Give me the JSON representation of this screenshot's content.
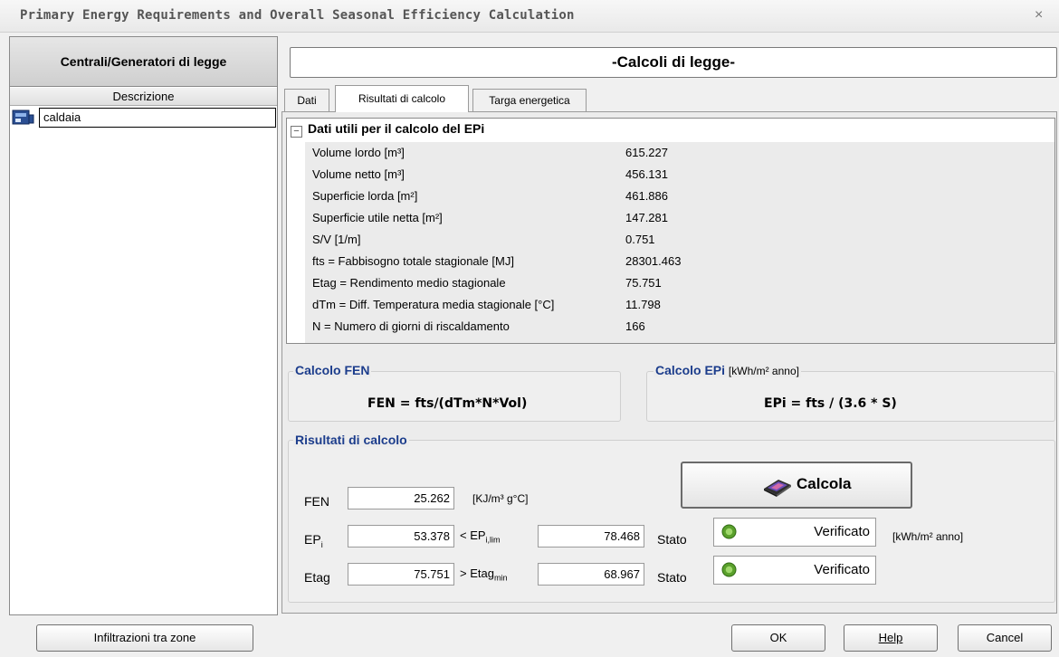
{
  "window": {
    "title": "Primary Energy Requirements and Overall Seasonal Efficiency Calculation",
    "close_glyph": "×"
  },
  "left_panel": {
    "header": "Centrali/Generatori di legge",
    "column_header": "Descrizione",
    "items": [
      {
        "label": "caldaia",
        "icon": "generator-icon"
      }
    ]
  },
  "main": {
    "banner": "-Calcoli di legge-",
    "tabs": [
      {
        "label": "Dati"
      },
      {
        "label": "Risultati di calcolo",
        "active": true
      },
      {
        "label": "Targa energetica"
      }
    ],
    "grid": {
      "expand_glyph": "−",
      "title": "Dati utili per il calcolo del EPi",
      "rows": [
        {
          "label": "Volume lordo [m³]",
          "value": "615.227"
        },
        {
          "label": "Volume netto [m³]",
          "value": "456.131"
        },
        {
          "label": "Superficie lorda [m²]",
          "value": "461.886"
        },
        {
          "label": "Superficie utile netta [m²]",
          "value": "147.281"
        },
        {
          "label": "S/V [1/m]",
          "value": "0.751"
        },
        {
          "label": "fts = Fabbisogno totale stagionale [MJ]",
          "value": "28301.463"
        },
        {
          "label": "Etag = Rendimento medio stagionale",
          "value": "75.751"
        },
        {
          "label": "dTm = Diff. Temperatura media stagionale [°C]",
          "value": "11.798"
        },
        {
          "label": "N = Numero di giorni di riscaldamento",
          "value": "166"
        }
      ]
    },
    "fen_box": {
      "title": "Calcolo FEN",
      "formula": "FEN = fts/(dTm*N*Vol)"
    },
    "epi_box": {
      "title": "Calcolo EPi",
      "unit": "[kWh/m² anno]",
      "formula": "EPi = fts / (3.6 * S)"
    },
    "results": {
      "title": "Risultati di calcolo",
      "calc_button": "Calcola",
      "fen": {
        "label": "FEN",
        "value": "25.262",
        "unit": "[KJ/m³ g°C]"
      },
      "epi": {
        "label": "EP",
        "label_sub": "i",
        "value": "53.378",
        "compare": "< EP",
        "compare_sub": "i,lim",
        "limit": "78.468",
        "stato_label": "Stato",
        "status": "Verificato",
        "unit": "[kWh/m² anno]"
      },
      "etag": {
        "label": "Etag",
        "value": "75.751",
        "compare": "> Etag",
        "compare_sub": "min",
        "limit": "68.967",
        "stato_label": "Stato",
        "status": "Verificato"
      }
    }
  },
  "footer": {
    "infiltrazioni": "Infiltrazioni tra zone",
    "ok": "OK",
    "help": "Help",
    "cancel": "Cancel"
  },
  "colors": {
    "group_title": "#1c3d8c",
    "status_led": "#5aa02c"
  }
}
